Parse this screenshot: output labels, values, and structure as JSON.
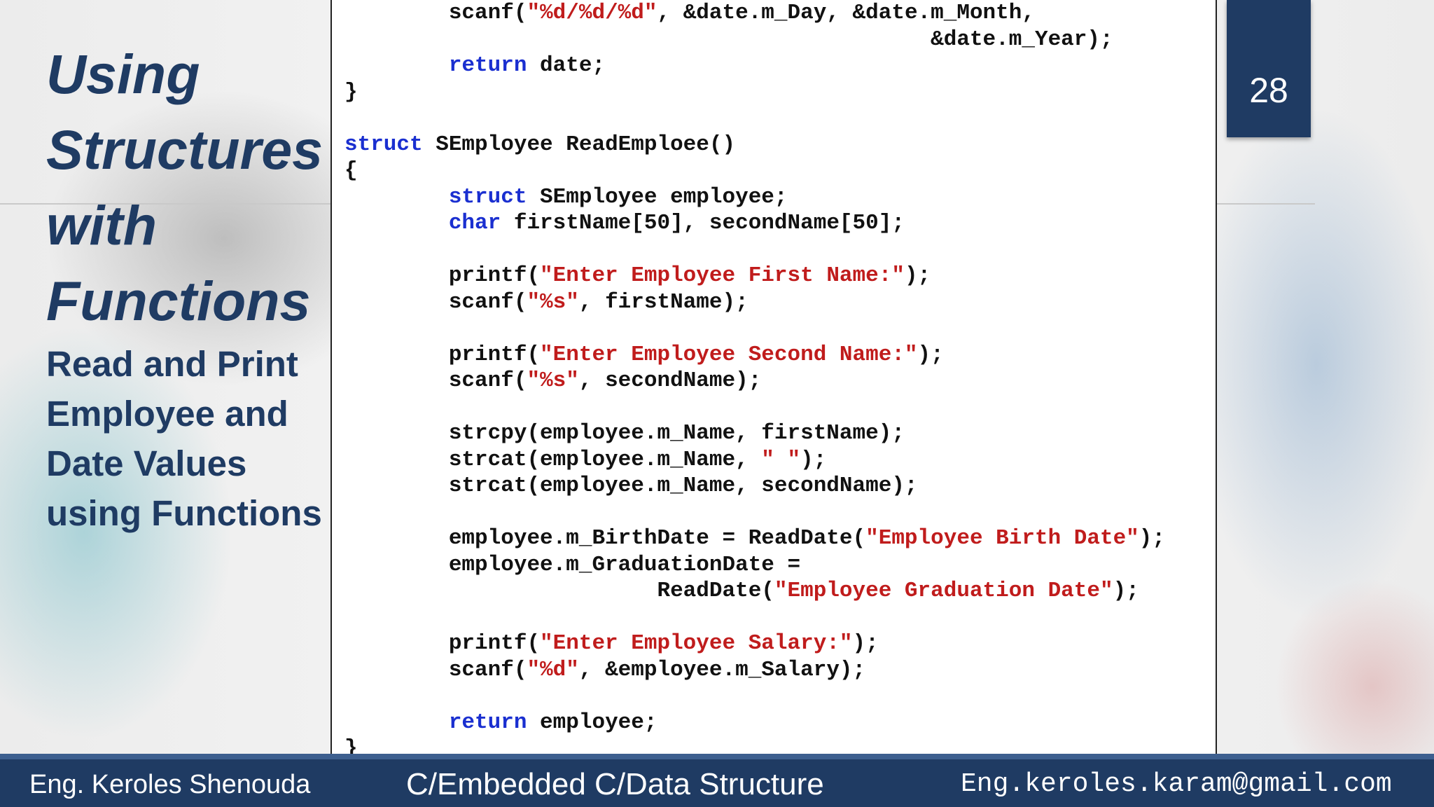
{
  "slide": {
    "title_main": "Using\nStructures\nwith\nFunctions",
    "title_sub": "Read and Print\nEmployee and\nDate Values\nusing Functions",
    "page_number": "28"
  },
  "code": {
    "lines": [
      [
        {
          "t": "        scanf(",
          "c": "p"
        },
        {
          "t": "\"%d/%d/%d\"",
          "c": "s"
        },
        {
          "t": ", &date.m_Day, &date.m_Month,",
          "c": "p"
        }
      ],
      [
        {
          "t": "                                             &date.m_Year);",
          "c": "p"
        }
      ],
      [
        {
          "t": "        ",
          "c": "p"
        },
        {
          "t": "return",
          "c": "k"
        },
        {
          "t": " date;",
          "c": "p"
        }
      ],
      [
        {
          "t": "}",
          "c": "p"
        }
      ],
      [],
      [
        {
          "t": "struct",
          "c": "k"
        },
        {
          "t": " SEmployee ReadEmploee()",
          "c": "p"
        }
      ],
      [
        {
          "t": "{",
          "c": "p"
        }
      ],
      [
        {
          "t": "        ",
          "c": "p"
        },
        {
          "t": "struct",
          "c": "k"
        },
        {
          "t": " SEmployee employee;",
          "c": "p"
        }
      ],
      [
        {
          "t": "        ",
          "c": "p"
        },
        {
          "t": "char",
          "c": "k"
        },
        {
          "t": " firstName[50], secondName[50];",
          "c": "p"
        }
      ],
      [],
      [
        {
          "t": "        printf(",
          "c": "p"
        },
        {
          "t": "\"Enter Employee First Name:\"",
          "c": "s"
        },
        {
          "t": ");",
          "c": "p"
        }
      ],
      [
        {
          "t": "        scanf(",
          "c": "p"
        },
        {
          "t": "\"%s\"",
          "c": "s"
        },
        {
          "t": ", firstName);",
          "c": "p"
        }
      ],
      [],
      [
        {
          "t": "        printf(",
          "c": "p"
        },
        {
          "t": "\"Enter Employee Second Name:\"",
          "c": "s"
        },
        {
          "t": ");",
          "c": "p"
        }
      ],
      [
        {
          "t": "        scanf(",
          "c": "p"
        },
        {
          "t": "\"%s\"",
          "c": "s"
        },
        {
          "t": ", secondName);",
          "c": "p"
        }
      ],
      [],
      [
        {
          "t": "        strcpy(employee.m_Name, firstName);",
          "c": "p"
        }
      ],
      [
        {
          "t": "        strcat(employee.m_Name, ",
          "c": "p"
        },
        {
          "t": "\" \"",
          "c": "s"
        },
        {
          "t": ");",
          "c": "p"
        }
      ],
      [
        {
          "t": "        strcat(employee.m_Name, secondName);",
          "c": "p"
        }
      ],
      [],
      [
        {
          "t": "        employee.m_BirthDate = ReadDate(",
          "c": "p"
        },
        {
          "t": "\"Employee Birth Date\"",
          "c": "s"
        },
        {
          "t": ");",
          "c": "p"
        }
      ],
      [
        {
          "t": "        employee.m_GraduationDate =",
          "c": "p"
        }
      ],
      [
        {
          "t": "                        ReadDate(",
          "c": "p"
        },
        {
          "t": "\"Employee Graduation Date\"",
          "c": "s"
        },
        {
          "t": ");",
          "c": "p"
        }
      ],
      [],
      [
        {
          "t": "        printf(",
          "c": "p"
        },
        {
          "t": "\"Enter Employee Salary:\"",
          "c": "s"
        },
        {
          "t": ");",
          "c": "p"
        }
      ],
      [
        {
          "t": "        scanf(",
          "c": "p"
        },
        {
          "t": "\"%d\"",
          "c": "s"
        },
        {
          "t": ", &employee.m_Salary);",
          "c": "p"
        }
      ],
      [],
      [
        {
          "t": "        ",
          "c": "p"
        },
        {
          "t": "return",
          "c": "k"
        },
        {
          "t": " employee;",
          "c": "p"
        }
      ],
      [
        {
          "t": "}",
          "c": "p"
        }
      ]
    ]
  },
  "footer": {
    "author": "Eng. Keroles Shenouda",
    "course": "C/Embedded C/Data Structure",
    "email": "Eng.keroles.karam@gmail.com"
  },
  "colors": {
    "brand_navy": "#1f3b63",
    "code_keyword": "#1a2fd0",
    "code_string": "#c01c1c",
    "code_plain": "#111111"
  }
}
